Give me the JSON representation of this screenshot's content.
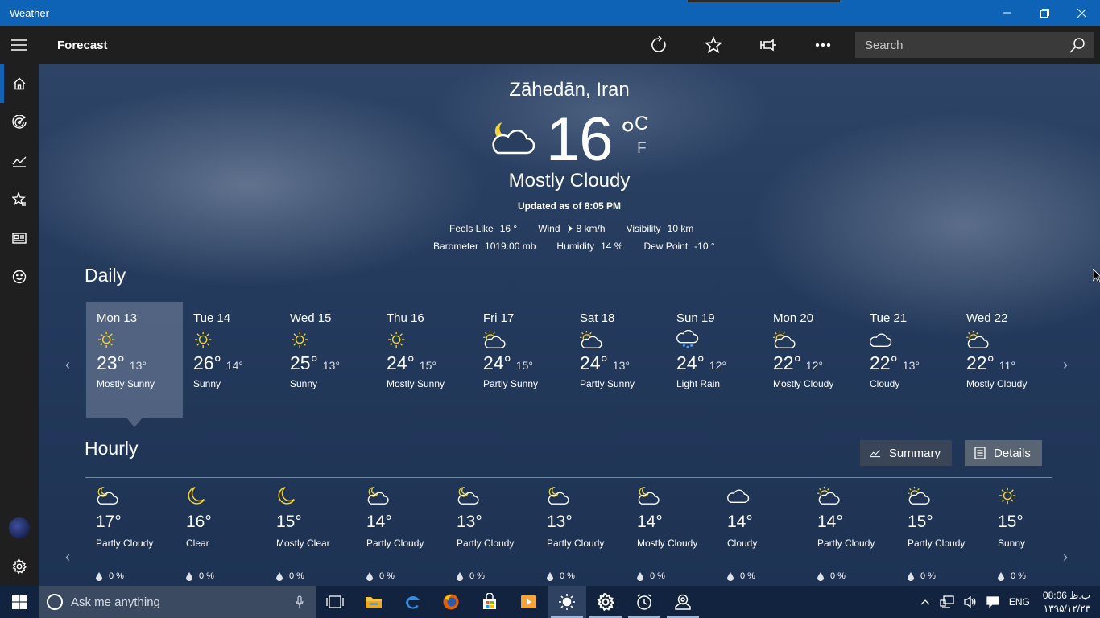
{
  "window": {
    "title": "Weather"
  },
  "toolbar": {
    "page_title": "Forecast",
    "search_placeholder": "Search"
  },
  "nav": [
    {
      "name": "home-icon"
    },
    {
      "name": "maps-icon"
    },
    {
      "name": "historical-weather-icon"
    },
    {
      "name": "places-icon"
    },
    {
      "name": "news-icon"
    },
    {
      "name": "feedback-smiley-icon"
    }
  ],
  "current": {
    "city": "Zāhedān, Iran",
    "temp": "16",
    "degree": "°",
    "unit_c": "C",
    "unit_f": "F",
    "condition": "Mostly Cloudy",
    "updated": "Updated as of 8:05 PM",
    "feels_like_label": "Feels Like",
    "feels_like": "16 °",
    "wind_label": "Wind",
    "wind": "8 km/h",
    "visibility_label": "Visibility",
    "visibility": "10 km",
    "barometer_label": "Barometer",
    "barometer": "1019.00 mb",
    "humidity_label": "Humidity",
    "humidity": "14 %",
    "dewpoint_label": "Dew Point",
    "dewpoint": "-10 °"
  },
  "daily": {
    "title": "Daily",
    "days": [
      {
        "date": "Mon 13",
        "hi": "23°",
        "lo": "13°",
        "cond": "Mostly Sunny",
        "icon": "sun"
      },
      {
        "date": "Tue 14",
        "hi": "26°",
        "lo": "14°",
        "cond": "Sunny",
        "icon": "sun"
      },
      {
        "date": "Wed 15",
        "hi": "25°",
        "lo": "13°",
        "cond": "Sunny",
        "icon": "sun"
      },
      {
        "date": "Thu 16",
        "hi": "24°",
        "lo": "15°",
        "cond": "Mostly Sunny",
        "icon": "sun"
      },
      {
        "date": "Fri 17",
        "hi": "24°",
        "lo": "15°",
        "cond": "Partly Sunny",
        "icon": "partly"
      },
      {
        "date": "Sat 18",
        "hi": "24°",
        "lo": "13°",
        "cond": "Partly Sunny",
        "icon": "partly"
      },
      {
        "date": "Sun 19",
        "hi": "24°",
        "lo": "12°",
        "cond": "Light Rain",
        "icon": "rain"
      },
      {
        "date": "Mon 20",
        "hi": "22°",
        "lo": "12°",
        "cond": "Mostly Cloudy",
        "icon": "partly"
      },
      {
        "date": "Tue 21",
        "hi": "22°",
        "lo": "13°",
        "cond": "Cloudy",
        "icon": "cloud"
      },
      {
        "date": "Wed 22",
        "hi": "22°",
        "lo": "11°",
        "cond": "Mostly Cloudy",
        "icon": "partly"
      }
    ]
  },
  "hourly": {
    "title": "Hourly",
    "summary_label": "Summary",
    "details_label": "Details",
    "hours": [
      {
        "temp": "17°",
        "cond": "Partly Cloudy",
        "precip": "0 %",
        "icon": "partly-night"
      },
      {
        "temp": "16°",
        "cond": "Clear",
        "precip": "0 %",
        "icon": "moon"
      },
      {
        "temp": "15°",
        "cond": "Mostly Clear",
        "precip": "0 %",
        "icon": "moon"
      },
      {
        "temp": "14°",
        "cond": "Partly Cloudy",
        "precip": "0 %",
        "icon": "partly-night"
      },
      {
        "temp": "13°",
        "cond": "Partly Cloudy",
        "precip": "0 %",
        "icon": "partly-night"
      },
      {
        "temp": "13°",
        "cond": "Partly Cloudy",
        "precip": "0 %",
        "icon": "partly-night"
      },
      {
        "temp": "14°",
        "cond": "Mostly Cloudy",
        "precip": "0 %",
        "icon": "partly-night"
      },
      {
        "temp": "14°",
        "cond": "Cloudy",
        "precip": "0 %",
        "icon": "cloud"
      },
      {
        "temp": "14°",
        "cond": "Partly Cloudy",
        "precip": "0 %",
        "icon": "partly"
      },
      {
        "temp": "15°",
        "cond": "Partly Cloudy",
        "precip": "0 %",
        "icon": "partly"
      },
      {
        "temp": "15°",
        "cond": "Sunny",
        "precip": "0 %",
        "icon": "sun"
      }
    ]
  },
  "taskbar": {
    "search_placeholder": "Ask me anything",
    "language": "ENG",
    "time": "08:06 ب.ظ",
    "date": "۱۳۹۵/۱۲/۲۳"
  },
  "colors": {
    "titlebar": "#0f63b7",
    "chrome": "#1f1f1f",
    "taskbar": "#12233f",
    "sun": "#f5d431"
  }
}
